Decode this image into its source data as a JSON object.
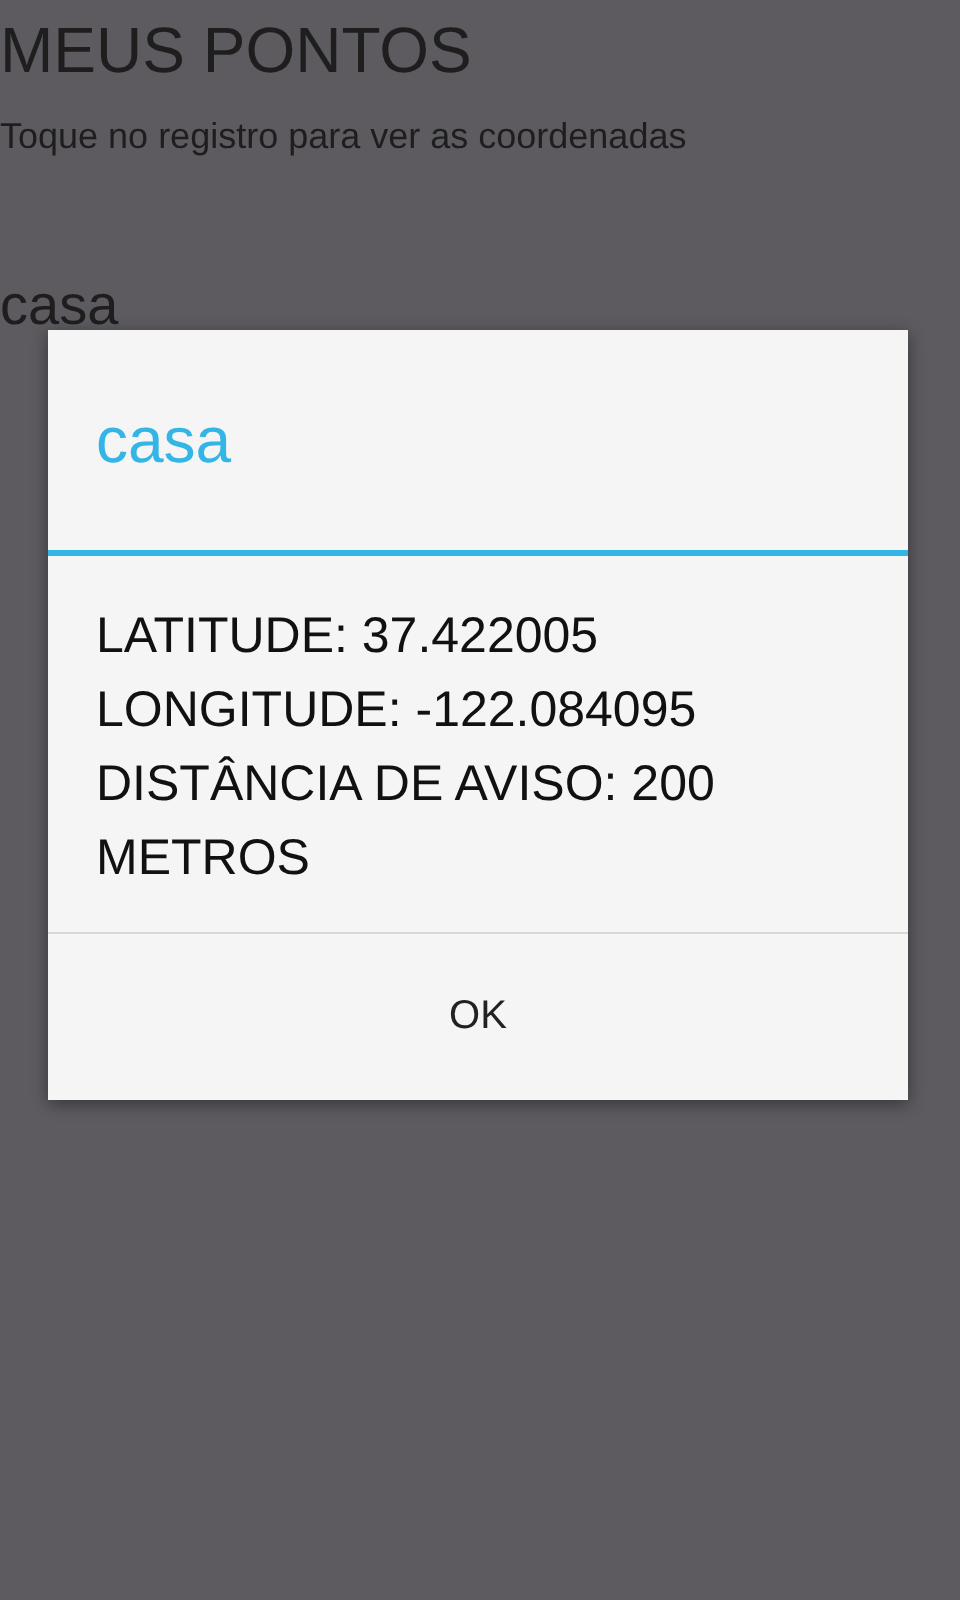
{
  "screen": {
    "title": "MEUS PONTOS",
    "subtitle": "Toque no registro para ver as coordenadas",
    "items": [
      "casa"
    ]
  },
  "dialog": {
    "title": "casa",
    "lines": [
      "LATITUDE: 37.422005",
      "LONGITUDE: -122.084095",
      "DISTÂNCIA DE AVISO: 200 METROS"
    ],
    "buttons": [
      "OK"
    ]
  }
}
